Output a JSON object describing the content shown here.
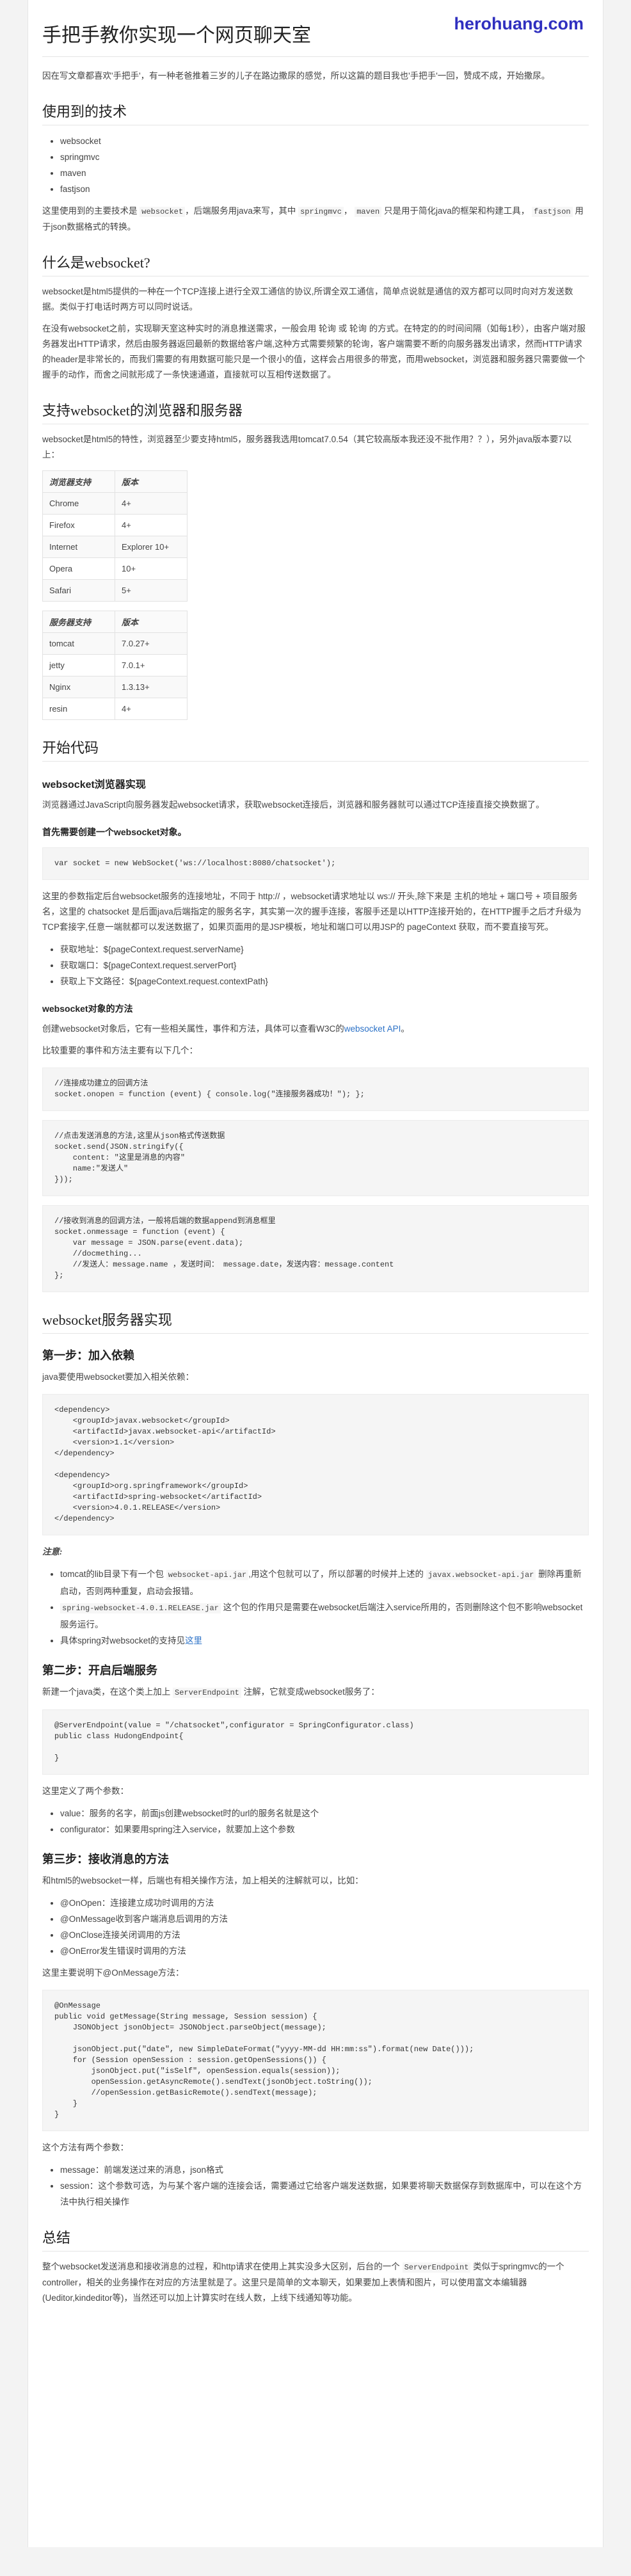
{
  "watermark": "herohuang.com",
  "title": "手把手教你实现一个网页聊天室",
  "intro": "因在写文章都喜欢'手把手'，有一种老爸推着三岁的儿子在路边撒尿的感觉，所以这篇的题目我也'手把手'一回，赞成不成，开始撒尿。",
  "s1": {
    "heading": "使用到的技术",
    "items": [
      "websocket",
      "springmvc",
      "maven",
      "fastjson"
    ],
    "p_a": "这里使用到的主要技术是",
    "p_code1": "websocket",
    "p_b": "，后端服务用java来写，其中",
    "p_code2": "springmvc",
    "p_c": "，",
    "p_code3": "maven",
    "p_d": "只是用于简化java的框架和构建工具，",
    "p_code4": "fastjson",
    "p_e": "用于json数据格式的转换。"
  },
  "s2": {
    "heading": "什么是websocket?",
    "p1": "websocket是html5提供的一种在一个TCP连接上进行全双工通信的协议,所谓全双工通信，简单点说就是通信的双方都可以同时向对方发送数据。类似于打电话时两方可以同时说话。",
    "p2": "在没有websocket之前，实现聊天室这种实时的消息推送需求，一般会用 轮询 或 轮询 的方式。在特定的的时间间隔（如每1秒），由客户端对服务器发出HTTP请求，然后由服务器返回最新的数据给客户端,这种方式需要频繁的轮询，客户端需要不断的向服务器发出请求，然而HTTP请求的header是非常长的，而我们需要的有用数据可能只是一个很小的值，这样会占用很多的带宽，而用websocket，浏览器和服务器只需要做一个握手的动作，而舍之间就形成了一条快速通道，直接就可以互相传送数据了。"
  },
  "s3": {
    "heading": "支持websocket的浏览器和服务器",
    "p": "websocket是html5的特性，浏览器至少要支持html5，服务器我选用tomcat7.0.54（其它较高版本我还没不批作用？？），另外java版本要7以上：",
    "browser_header": [
      "浏览器支持",
      "版本"
    ],
    "browsers": [
      [
        "Chrome",
        "4+"
      ],
      [
        "Firefox",
        "4+"
      ],
      [
        "Internet",
        "Explorer 10+"
      ],
      [
        "Opera",
        "10+"
      ],
      [
        "Safari",
        "5+"
      ]
    ],
    "server_header": [
      "服务器支持",
      "版本"
    ],
    "servers": [
      [
        "tomcat",
        "7.0.27+"
      ],
      [
        "jetty",
        "7.0.1+"
      ],
      [
        "Nginx",
        "1.3.13+"
      ],
      [
        "resin",
        "4+"
      ]
    ]
  },
  "s4": {
    "heading": "开始代码",
    "sub1": "websocket浏览器实现",
    "p1": "浏览器通过JavaScript向服务器发起websocket请求，获取websocket连接后，浏览器和服务器就可以通过TCP连接直接交换数据了。",
    "sub2": "首先需要创建一个websocket对象。",
    "code1": "var socket = new WebSocket('ws://localhost:8080/chatsocket');",
    "p2": "这里的参数指定后台websocket服务的连接地址，不同于 http:// ，websocket请求地址以 ws:// 开头,除下来是 主机的地址 + 端口号 + 项目服务名，这里的 chatsocket 是后面java后端指定的服务名字，其实第一次的握手连接，客服手还是以HTTP连接开始的，在HTTP握手之后才升级为TCP套接字,任意一端就都可以发送数据了，如果页面用的是JSP模板，地址和端口可以用JSP的 pageContext 获取，而不要直接写死。",
    "bullets": [
      "获取地址：${pageContext.request.serverName}",
      "获取端口：${pageContext.request.serverPort}",
      "获取上下文路径：${pageContext.request.contextPath}"
    ],
    "sub3": "websocket对象的方法",
    "p3a": "创建websocket对象后，它有一些相关属性，事件和方法，具体可以查看W3C的",
    "p3link": "websocket API",
    "p3b": "。",
    "p4": "比较重要的事件和方法主要有以下几个：",
    "code2": "//连接成功建立的回调方法\nsocket.onopen = function (event) { console.log(\"连接服务器成功！\"); };",
    "code3": "//点击发送消息的方法,这里从json格式传送数据\nsocket.send(JSON.stringify({\n    content: \"这里是消息的内容\"\n    name:\"发送人\"\n}));",
    "code4": "//接收到消息的回调方法，一般将后端的数据append到消息框里\nsocket.onmessage = function (event) {\n    var message = JSON.parse(event.data);\n    //docmething...\n    //发送人：message.name ，发送时间： message.date，发送内容：message.content\n};"
  },
  "s5": {
    "heading": "websocket服务器实现",
    "step1": "第一步：加入依赖",
    "step1_p": "java要使用websocket要加入相关依赖：",
    "code5": "<dependency>\n    <groupId>javax.websocket</groupId>\n    <artifactId>javax.websocket-api</artifactId>\n    <version>1.1</version>\n</dependency>\n\n<dependency>\n    <groupId>org.springframework</groupId>\n    <artifactId>spring-websocket</artifactId>\n    <version>4.0.1.RELEASE</version>\n</dependency>",
    "note": "注意:",
    "notes": [
      {
        "a": "tomcat的lib目录下有一个包",
        "c": "websocket-api.jar",
        "b": ",用这个包就可以了，所以部署的时候并上述的",
        "c2": "javax.websocket-api.jar",
        "b2": "删除再重新启动，否则两种重复，启动会报错。"
      },
      {
        "a": "",
        "c": "spring-websocket-4.0.1.RELEASE.jar",
        "b": "这个包的作用只是需要在websocket后端注入service所用的，否则删除这个包不影响websocket服务运行。",
        "c2": "",
        "b2": ""
      },
      {
        "a": "具体spring对websocket的支持见",
        "c": "",
        "b": "",
        "c2": "",
        "b2": "",
        "link": "这里"
      }
    ],
    "step2": "第二步：开启后端服务",
    "step2_pa": "新建一个java类，在这个类上加上",
    "step2_code": "ServerEndpoint",
    "step2_pb": "注解，它就变成websocket服务了：",
    "code6": "@ServerEndpoint(value = \"/chatsocket\",configurator = SpringConfigurator.class)\npublic class HudongEndpoint{\n\n}",
    "step2_p2": "这里定义了两个参数：",
    "step2_items": [
      "value：服务的名字，前面js创建websocket时的url的服务名就是这个",
      "configurator：如果要用spring注入service，就要加上这个参数"
    ],
    "step3": "第三步：接收消息的方法",
    "step3_p": "和html5的websocket一样，后端也有相关操作方法，加上相关的注解就可以，比如：",
    "step3_items": [
      "@OnOpen：连接建立成功时调用的方法",
      "@OnMessage收到客户端消息后调用的方法",
      "@OnClose连接关闭调用的方法",
      "@OnError发生错误时调用的方法"
    ],
    "step3_p2": "这里主要说明下@OnMessage方法：",
    "code7": "@OnMessage\npublic void getMessage(String message, Session session) {\n    JSONObject jsonObject= JSONObject.parseObject(message);\n\n    jsonObject.put(\"date\", new SimpleDateFormat(\"yyyy-MM-dd HH:mm:ss\").format(new Date()));\n    for (Session openSession : session.getOpenSessions()) {\n        jsonObject.put(\"isSelf\", openSession.equals(session));\n        openSession.getAsyncRemote().sendText(jsonObject.toString());\n        //openSession.getBasicRemote().sendText(message);\n    }\n}",
    "step3_p3": "这个方法有两个参数：",
    "step3_items2": [
      "message：前端发送过来的消息，json格式",
      "session：这个参数可选，为与某个客户端的连接会话，需要通过它给客户端发送数据，如果要将聊天数据保存到数据库中，可以在这个方法中执行相关操作"
    ]
  },
  "s6": {
    "heading": "总结",
    "p_a": "整个websocket发送消息和接收消息的过程，和http请求在使用上其实没多大区别，后台的一个",
    "p_code": "ServerEndpoint",
    "p_b": "类似于springmvc的一个controller，相关的业务操作在对应的方法里就是了。这里只是简单的文本聊天，如果要加上表情和图片，可以使用富文本编辑器(Ueditor,kindeditor等)，当然还可以加上计算实时在线人数，上线下线通知等功能。"
  }
}
